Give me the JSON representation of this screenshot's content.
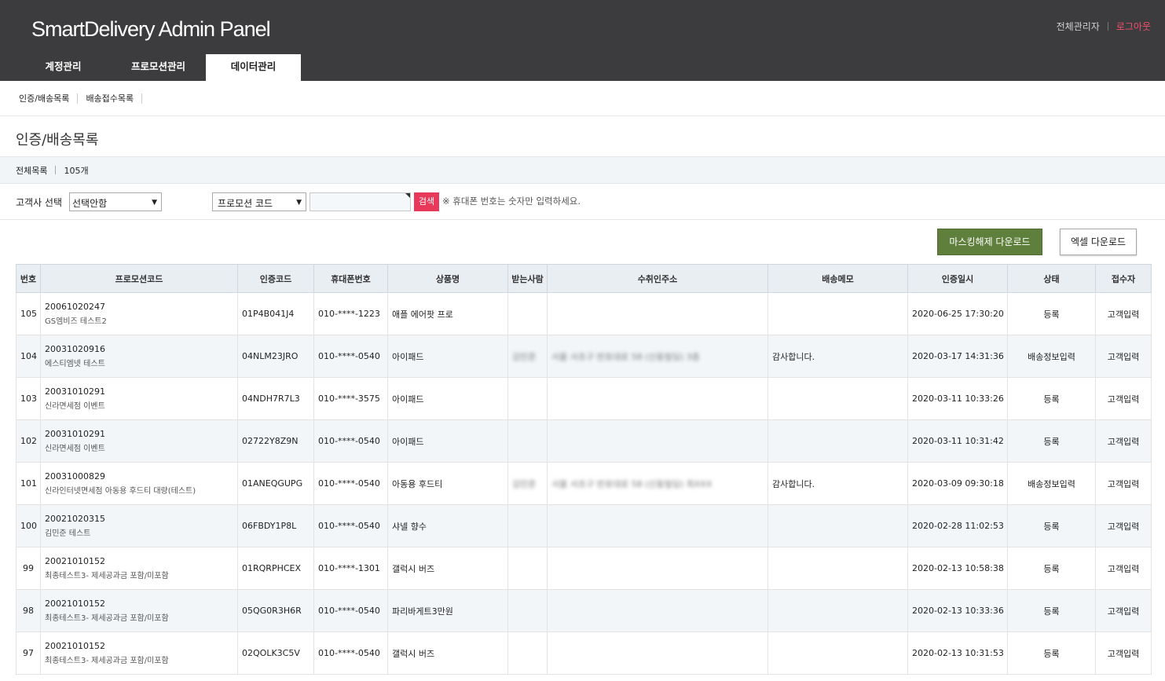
{
  "header": {
    "brand": "SmartDelivery Admin Panel",
    "user_name": "전체관리자",
    "logout_label": "로그아웃",
    "tabs": [
      {
        "label": "계정관리"
      },
      {
        "label": "프로모션관리"
      },
      {
        "label": "데이터관리"
      }
    ],
    "active_tab": "데이터관리"
  },
  "subnav": {
    "items": [
      {
        "label": "인증/배송목록"
      },
      {
        "label": "배송접수목록"
      }
    ]
  },
  "page": {
    "title": "인증/배송목록",
    "summary_label": "전체목록",
    "summary_count": "105개"
  },
  "filter": {
    "client_label": "고객사 선택",
    "client_selected": "선택안함",
    "search_type_selected": "프로모션 코드",
    "search_value": "",
    "search_button": "검색",
    "hint": "※ 휴대폰 번호는 숫자만 입력하세요."
  },
  "actions": {
    "unmask_download": "마스킹해제 다운로드",
    "excel_download": "엑셀 다운로드"
  },
  "table": {
    "headers": [
      "번호",
      "프로모션코드",
      "인증코드",
      "휴대폰번호",
      "상품명",
      "받는사람",
      "수취인주소",
      "배송메모",
      "인증일시",
      "상태",
      "접수자"
    ],
    "rows": [
      {
        "no": "105",
        "promo_code": "20061020247",
        "promo_name": "GS엠비즈 테스트2",
        "auth_code": "01P4B041J4",
        "phone": "010-****-1223",
        "product": "애플 에어팟 프로",
        "receiver": "",
        "address": "",
        "memo": "",
        "date": "2020-06-25 17:30:20",
        "status": "등록",
        "registrar": "고객입력"
      },
      {
        "no": "104",
        "promo_code": "20031020916",
        "promo_name": "에스티엠넷 테스트",
        "auth_code": "04NLM23JRO",
        "phone": "010-****-0540",
        "product": "아이패드",
        "receiver": "김민준",
        "address": "서울 서초구 반포대로 58 (신동빌딩) 3층",
        "memo": "감사합니다.",
        "date": "2020-03-17 14:31:36",
        "status": "배송정보입력",
        "registrar": "고객입력"
      },
      {
        "no": "103",
        "promo_code": "20031010291",
        "promo_name": "신라면세점 이벤트",
        "auth_code": "04NDH7R7L3",
        "phone": "010-****-3575",
        "product": "아이패드",
        "receiver": "",
        "address": "",
        "memo": "",
        "date": "2020-03-11 10:33:26",
        "status": "등록",
        "registrar": "고객입력"
      },
      {
        "no": "102",
        "promo_code": "20031010291",
        "promo_name": "신라면세점 이벤트",
        "auth_code": "02722Y8Z9N",
        "phone": "010-****-0540",
        "product": "아이패드",
        "receiver": "",
        "address": "",
        "memo": "",
        "date": "2020-03-11 10:31:42",
        "status": "등록",
        "registrar": "고객입력"
      },
      {
        "no": "101",
        "promo_code": "20031000829",
        "promo_name": "신라인터넷면세점 아동용 후드티 대량(테스트)",
        "auth_code": "01ANEQGUPG",
        "phone": "010-****-0540",
        "product": "아동용 후드티",
        "receiver": "김민준",
        "address": "서울 서초구 반포대로 58 (신동빌딩) 최XXX",
        "memo": "감사합니다.",
        "date": "2020-03-09 09:30:18",
        "status": "배송정보입력",
        "registrar": "고객입력"
      },
      {
        "no": "100",
        "promo_code": "20021020315",
        "promo_name": "김민준 테스트",
        "auth_code": "06FBDY1P8L",
        "phone": "010-****-0540",
        "product": "샤넬 향수",
        "receiver": "",
        "address": "",
        "memo": "",
        "date": "2020-02-28 11:02:53",
        "status": "등록",
        "registrar": "고객입력"
      },
      {
        "no": "99",
        "promo_code": "20021010152",
        "promo_name": "최종테스트3- 제세공과금 포함/미포함",
        "auth_code": "01RQRPHCEX",
        "phone": "010-****-1301",
        "product": "갤럭시 버즈",
        "receiver": "",
        "address": "",
        "memo": "",
        "date": "2020-02-13 10:58:38",
        "status": "등록",
        "registrar": "고객입력"
      },
      {
        "no": "98",
        "promo_code": "20021010152",
        "promo_name": "최종테스트3- 제세공과금 포함/미포함",
        "auth_code": "05QG0R3H6R",
        "phone": "010-****-0540",
        "product": "파리바게트3만원",
        "receiver": "",
        "address": "",
        "memo": "",
        "date": "2020-02-13 10:33:36",
        "status": "등록",
        "registrar": "고객입력"
      },
      {
        "no": "97",
        "promo_code": "20021010152",
        "promo_name": "최종테스트3- 제세공과금 포함/미포함",
        "auth_code": "02QOLK3C5V",
        "phone": "010-****-0540",
        "product": "갤럭시 버즈",
        "receiver": "",
        "address": "",
        "memo": "",
        "date": "2020-02-13 10:31:53",
        "status": "등록",
        "registrar": "고객입력"
      }
    ]
  }
}
